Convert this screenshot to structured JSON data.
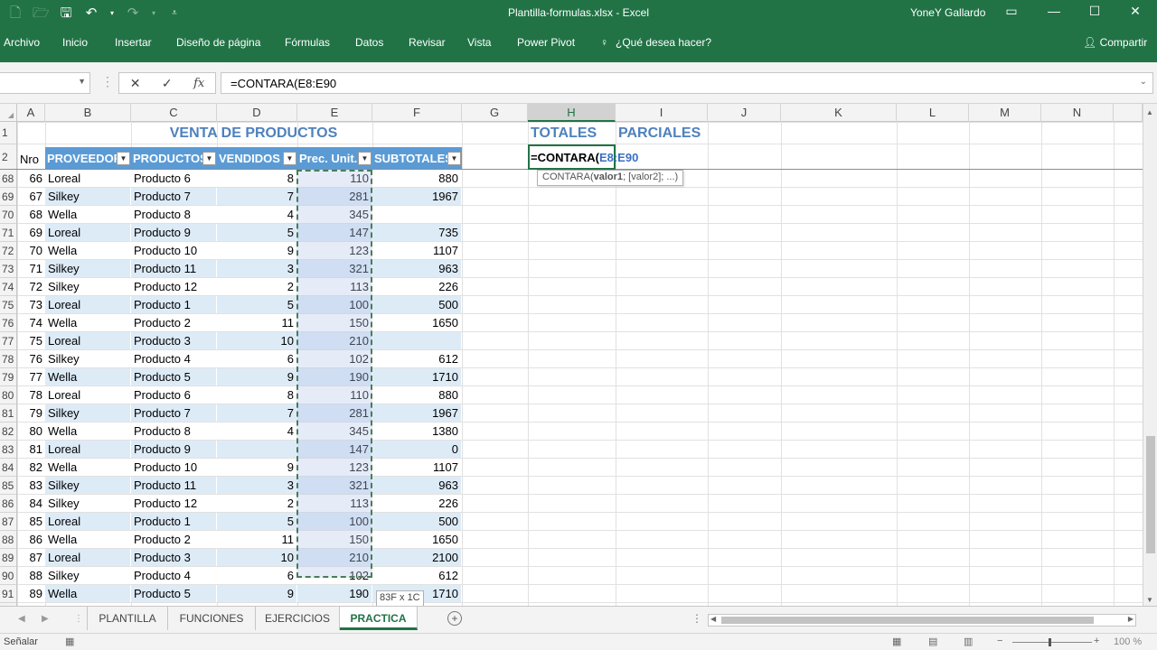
{
  "window": {
    "title": "Plantilla-formulas.xlsx  -  Excel",
    "user": "YoneY Gallardo"
  },
  "ribbon": {
    "tabs": [
      "Archivo",
      "Inicio",
      "Insertar",
      "Diseño de página",
      "Fórmulas",
      "Datos",
      "Revisar",
      "Vista",
      "Power Pivot",
      "¿Qué desea hacer?"
    ],
    "share": "Compartir"
  },
  "formula_bar": {
    "name_box": "",
    "fx": "fx",
    "value": "=CONTARA(E8:E90"
  },
  "columns": [
    "A",
    "B",
    "C",
    "D",
    "E",
    "F",
    "G",
    "H",
    "I",
    "J",
    "K",
    "L",
    "M",
    "N"
  ],
  "sheet": {
    "title": "VENTA DE PRODUCTOS",
    "totales": "TOTALES",
    "parciales": "PARCIALES",
    "col_a_header": "Nro",
    "headers": [
      "PROVEEDOR",
      "PRODUCTOS",
      "VENDIDOS",
      "Prec. Unit.",
      "SUBTOTALES"
    ],
    "header_row_number": "2",
    "title_row_number": "1",
    "active_cell_formula_prefix": "=CONTARA(",
    "active_cell_formula_ref": "E8:E90",
    "tooltip": "CONTARA(valor1; [valor2]; ...)",
    "tooltip_bold": "valor1",
    "size_tip": "83F x 1C",
    "rows": [
      {
        "r": "68",
        "nro": "66",
        "prov": "Loreal",
        "prod": "Producto 6",
        "vend": "8",
        "prec": "110",
        "sub": "880"
      },
      {
        "r": "69",
        "nro": "67",
        "prov": "Silkey",
        "prod": "Producto 7",
        "vend": "7",
        "prec": "281",
        "sub": "1967"
      },
      {
        "r": "70",
        "nro": "68",
        "prov": "Wella",
        "prod": "Producto 8",
        "vend": "4",
        "prec": "345",
        "sub": ""
      },
      {
        "r": "71",
        "nro": "69",
        "prov": "Loreal",
        "prod": "Producto 9",
        "vend": "5",
        "prec": "147",
        "sub": "735"
      },
      {
        "r": "72",
        "nro": "70",
        "prov": "Wella",
        "prod": "Producto 10",
        "vend": "9",
        "prec": "123",
        "sub": "1107"
      },
      {
        "r": "73",
        "nro": "71",
        "prov": "Silkey",
        "prod": "Producto 11",
        "vend": "3",
        "prec": "321",
        "sub": "963"
      },
      {
        "r": "74",
        "nro": "72",
        "prov": "Silkey",
        "prod": "Producto 12",
        "vend": "2",
        "prec": "113",
        "sub": "226"
      },
      {
        "r": "75",
        "nro": "73",
        "prov": "Loreal",
        "prod": "Producto 1",
        "vend": "5",
        "prec": "100",
        "sub": "500"
      },
      {
        "r": "76",
        "nro": "74",
        "prov": "Wella",
        "prod": "Producto 2",
        "vend": "11",
        "prec": "150",
        "sub": "1650"
      },
      {
        "r": "77",
        "nro": "75",
        "prov": "Loreal",
        "prod": "Producto 3",
        "vend": "10",
        "prec": "210",
        "sub": ""
      },
      {
        "r": "78",
        "nro": "76",
        "prov": "Silkey",
        "prod": "Producto 4",
        "vend": "6",
        "prec": "102",
        "sub": "612"
      },
      {
        "r": "79",
        "nro": "77",
        "prov": "Wella",
        "prod": "Producto 5",
        "vend": "9",
        "prec": "190",
        "sub": "1710"
      },
      {
        "r": "80",
        "nro": "78",
        "prov": "Loreal",
        "prod": "Producto 6",
        "vend": "8",
        "prec": "110",
        "sub": "880"
      },
      {
        "r": "81",
        "nro": "79",
        "prov": "Silkey",
        "prod": "Producto 7",
        "vend": "7",
        "prec": "281",
        "sub": "1967"
      },
      {
        "r": "82",
        "nro": "80",
        "prov": "Wella",
        "prod": "Producto 8",
        "vend": "4",
        "prec": "345",
        "sub": "1380"
      },
      {
        "r": "83",
        "nro": "81",
        "prov": "Loreal",
        "prod": "Producto 9",
        "vend": "",
        "prec": "147",
        "sub": "0"
      },
      {
        "r": "84",
        "nro": "82",
        "prov": "Wella",
        "prod": "Producto 10",
        "vend": "9",
        "prec": "123",
        "sub": "1107"
      },
      {
        "r": "85",
        "nro": "83",
        "prov": "Silkey",
        "prod": "Producto 11",
        "vend": "3",
        "prec": "321",
        "sub": "963"
      },
      {
        "r": "86",
        "nro": "84",
        "prov": "Silkey",
        "prod": "Producto 12",
        "vend": "2",
        "prec": "113",
        "sub": "226"
      },
      {
        "r": "87",
        "nro": "85",
        "prov": "Loreal",
        "prod": "Producto 1",
        "vend": "5",
        "prec": "100",
        "sub": "500"
      },
      {
        "r": "88",
        "nro": "86",
        "prov": "Wella",
        "prod": "Producto 2",
        "vend": "11",
        "prec": "150",
        "sub": "1650"
      },
      {
        "r": "89",
        "nro": "87",
        "prov": "Loreal",
        "prod": "Producto 3",
        "vend": "10",
        "prec": "210",
        "sub": "2100"
      },
      {
        "r": "90",
        "nro": "88",
        "prov": "Silkey",
        "prod": "Producto 4",
        "vend": "6",
        "prec": "102",
        "sub": "612"
      },
      {
        "r": "91",
        "nro": "89",
        "prov": "Wella",
        "prod": "Producto 5",
        "vend": "9",
        "prec": "190",
        "sub": "1710"
      }
    ]
  },
  "sheet_tabs": [
    "PLANTILLA",
    "FUNCIONES",
    "EJERCICIOS",
    "PRACTICA"
  ],
  "active_sheet": "PRACTICA",
  "status": {
    "mode": "Señalar",
    "zoom": "100 %"
  },
  "colors": {
    "excel_green": "#217346",
    "table_header": "#5b9bd5",
    "band": "#ddebf7",
    "title_blue": "#4f81bd"
  }
}
